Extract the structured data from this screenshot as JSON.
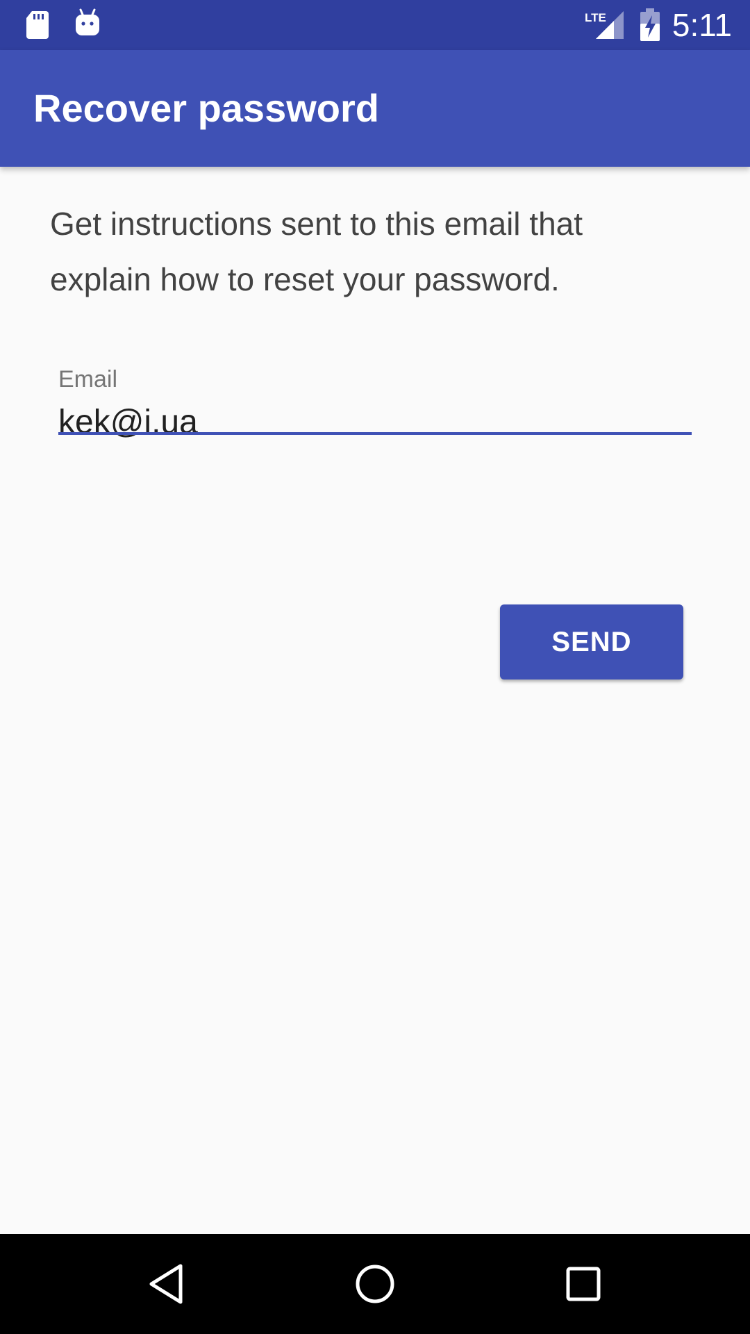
{
  "status_bar": {
    "time": "5:11",
    "network": "LTE",
    "icons": [
      "sd-card-icon",
      "android-icon",
      "lte-signal-icon",
      "battery-charging-icon"
    ]
  },
  "app_bar": {
    "title": "Recover password"
  },
  "content": {
    "instructions": "Get instructions sent to this email that explain how to reset your password.",
    "email_field": {
      "label": "Email",
      "value": "kek@i.ua"
    },
    "send_button": "SEND"
  },
  "navigation": {
    "icons": [
      "back-icon",
      "home-icon",
      "recents-icon"
    ]
  },
  "colors": {
    "status_bar": "#303f9f",
    "primary": "#3f51b5",
    "background": "#fafafa",
    "text": "#424242"
  }
}
